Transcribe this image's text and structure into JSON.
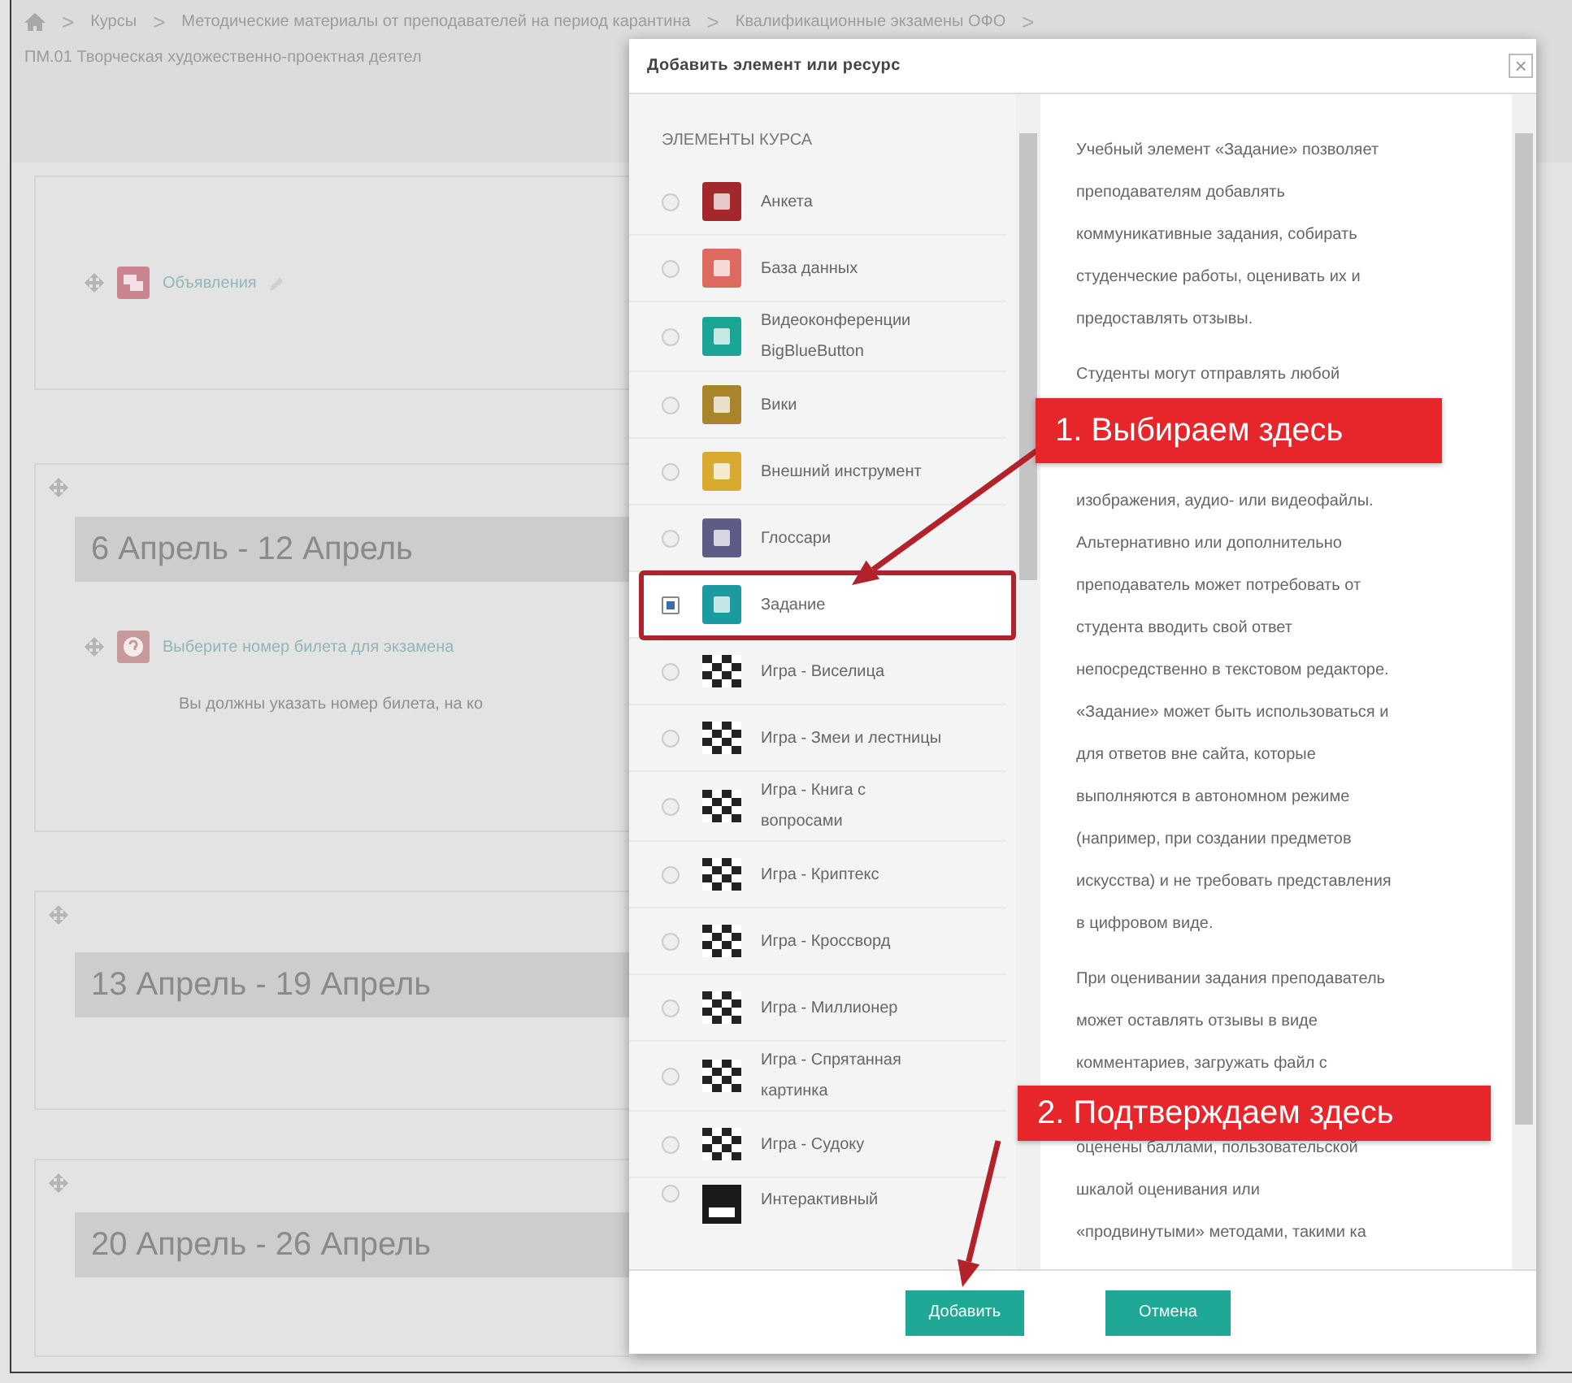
{
  "breadcrumb": {
    "separator": ">",
    "items": [
      "Курсы",
      "Методические материалы от преподавателей на период карантина",
      "Квалификационные экзамены ОФО"
    ],
    "course_title": "ПМ.01 Творческая художественно-проектная деятел"
  },
  "sections": [
    {
      "items": [
        {
          "kind": "forum",
          "title": "Объявления"
        }
      ]
    },
    {
      "heading": "6 Апрель - 12 Апрель",
      "items": [
        {
          "kind": "question",
          "title": "Выберите номер билета для экзамена",
          "note": "Вы должны указать номер билета, на ко"
        }
      ]
    },
    {
      "heading": "13 Апрель - 19 Апрель"
    },
    {
      "heading": "20 Апрель - 26 Апрель"
    }
  ],
  "dialog": {
    "title": "Добавить элемент или ресурс",
    "close": "×",
    "list_heading": "ЭЛЕМЕНТЫ КУРСА",
    "options": [
      {
        "label": "Анкета",
        "kind": "tile",
        "color": "#a3282c",
        "selected": false
      },
      {
        "label": "База данных",
        "kind": "tile",
        "color": "#dd6a5e",
        "selected": false
      },
      {
        "label": "Видеоконференции BigBlueButton",
        "kind": "tile",
        "color": "#1aa595",
        "selected": false
      },
      {
        "label": "Вики",
        "kind": "tile",
        "color": "#a8842a",
        "selected": false
      },
      {
        "label": "Внешний инструмент",
        "kind": "tile",
        "color": "#d8aa30",
        "selected": false
      },
      {
        "label": "Глоссари",
        "kind": "tile",
        "color": "#5c5c86",
        "selected": false
      },
      {
        "label": "Задание",
        "kind": "tile",
        "color": "#1b9aa0",
        "selected": true
      },
      {
        "label": "Игра - Виселица",
        "kind": "game",
        "selected": false
      },
      {
        "label": "Игра - Змеи и лестницы",
        "kind": "game",
        "selected": false
      },
      {
        "label": "Игра - Книга с вопросами",
        "kind": "game",
        "selected": false
      },
      {
        "label": "Игра - Криптекс",
        "kind": "game",
        "selected": false
      },
      {
        "label": "Игра - Кроссворд",
        "kind": "game",
        "selected": false
      },
      {
        "label": "Игра - Миллионер",
        "kind": "game",
        "selected": false
      },
      {
        "label": "Игра - Спрятанная картинка",
        "kind": "game",
        "selected": false
      },
      {
        "label": "Игра - Судоку",
        "kind": "game",
        "selected": false
      },
      {
        "label": "Интерактивный",
        "kind": "content",
        "selected": false
      }
    ],
    "description": [
      {
        "kind": "text",
        "text": "Учебный элемент «Задание» позволяет"
      },
      {
        "kind": "text",
        "text": "преподавателям добавлять"
      },
      {
        "kind": "text",
        "text": "коммуникативные задания, собирать"
      },
      {
        "kind": "text",
        "text": "студенческие работы, оценивать их и"
      },
      {
        "kind": "text",
        "text": "предоставлять отзывы."
      },
      {
        "kind": "break"
      },
      {
        "kind": "text",
        "text": "Студенты могут отправлять любой"
      },
      {
        "kind": "covered"
      },
      {
        "kind": "covered"
      },
      {
        "kind": "text",
        "text": "изображения, аудио- или видеофайлы."
      },
      {
        "kind": "text",
        "text": "Альтернативно или дополнительно"
      },
      {
        "kind": "text",
        "text": "преподаватель может потребовать от"
      },
      {
        "kind": "text",
        "text": "студента вводить свой ответ"
      },
      {
        "kind": "text",
        "text": "непосредственно в текстовом редакторе."
      },
      {
        "kind": "text",
        "text": "«Задание» может быть использоваться и"
      },
      {
        "kind": "text",
        "text": "для ответов вне сайта, которые"
      },
      {
        "kind": "text",
        "text": "выполняются в автономном режиме"
      },
      {
        "kind": "text",
        "text": "(например, при создании предметов"
      },
      {
        "kind": "text",
        "text": "искусства) и не требовать представления"
      },
      {
        "kind": "text",
        "text": "в цифровом виде."
      },
      {
        "kind": "break"
      },
      {
        "kind": "text",
        "text": "При оценивании задания преподаватель"
      },
      {
        "kind": "text",
        "text": "может оставлять отзывы в виде"
      },
      {
        "kind": "text",
        "text": "комментариев, загружать файл с"
      },
      {
        "kind": "covered"
      },
      {
        "kind": "text",
        "text": "оценены баллами, пользовательской"
      },
      {
        "kind": "text",
        "text": "шкалой оценивания или"
      },
      {
        "kind": "text",
        "text": "«продвинутыми» методами, такими ка"
      }
    ],
    "buttons": [
      "Добавить",
      "Отмена"
    ]
  },
  "annotations": [
    "1. Выбираем здесь",
    "2. Подтверждаем здесь"
  ]
}
